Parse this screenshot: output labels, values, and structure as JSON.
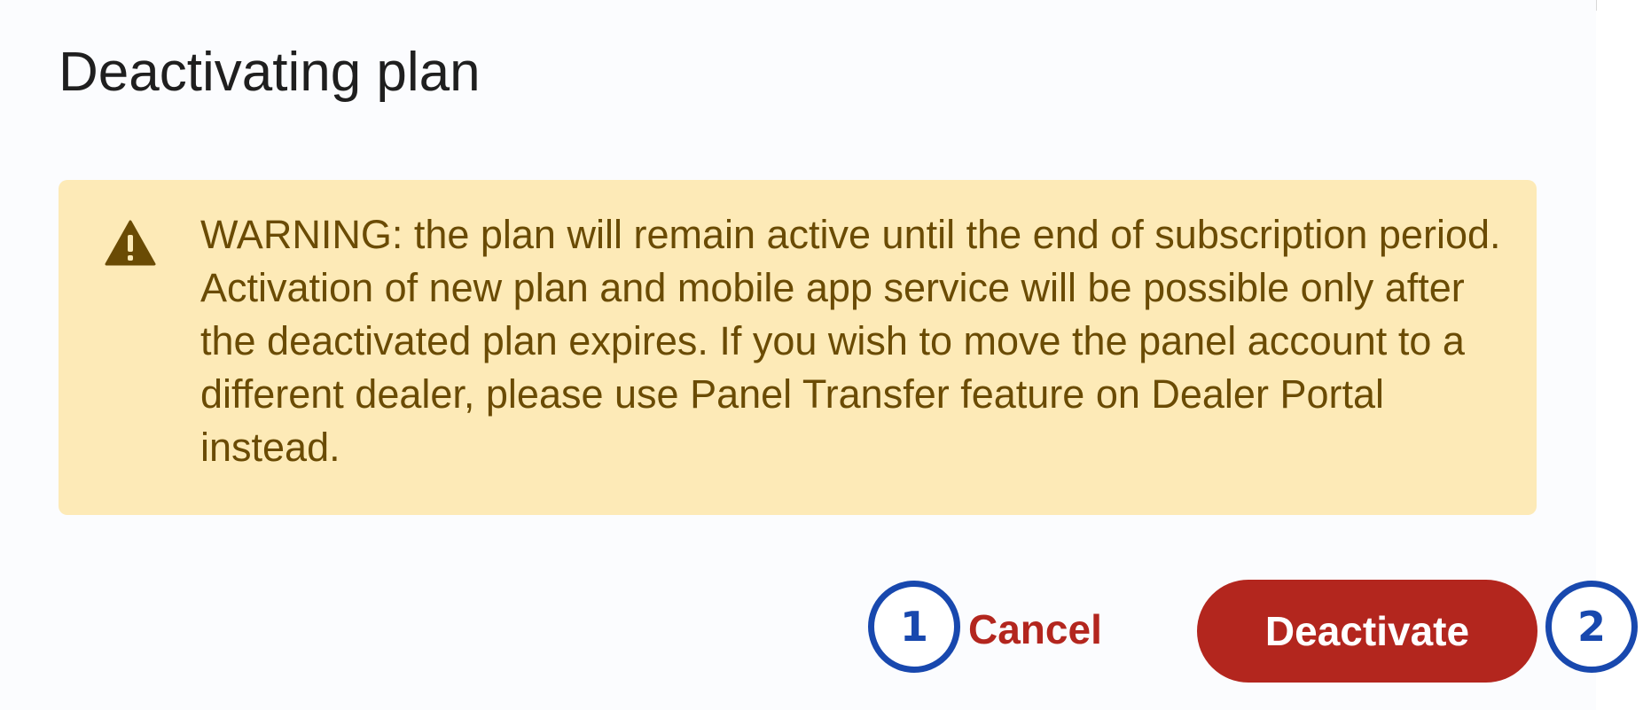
{
  "dialog": {
    "title": "Deactivating plan",
    "warning": {
      "icon": "warning-triangle-icon",
      "text": "WARNING: the plan will remain active until the end of subscription period. Activation of new plan and mobile app service will be possible only after the deactivated plan expires. If you wish to move the panel account to a different dealer, please use Panel Transfer feature on Dealer Portal instead."
    },
    "actions": {
      "cancel_label": "Cancel",
      "deactivate_label": "Deactivate"
    }
  },
  "annotations": [
    {
      "label": "1"
    },
    {
      "label": "2"
    }
  ],
  "colors": {
    "danger": "#b3261e",
    "warning_background": "#fdeab7",
    "warning_text": "#6a4b04",
    "annotation": "#1848ae"
  }
}
